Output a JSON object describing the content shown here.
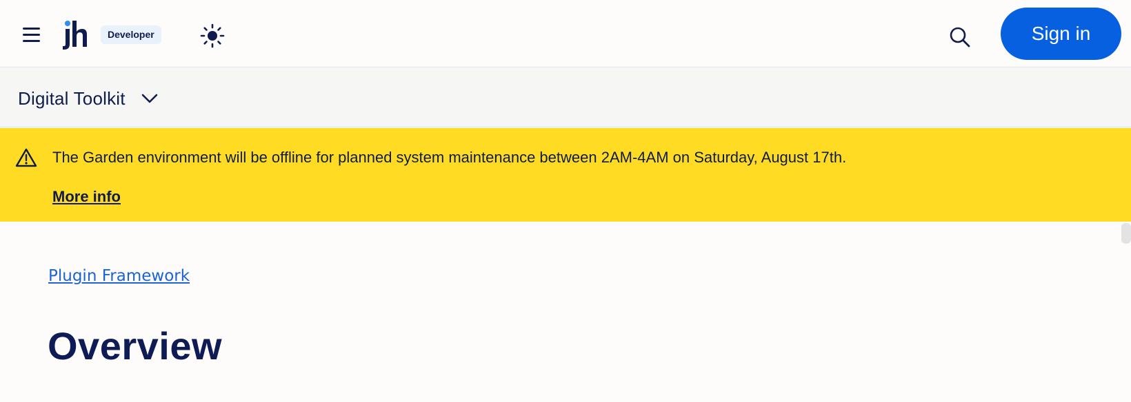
{
  "header": {
    "logo_text": "jh",
    "badge": "Developer",
    "sign_in_label": "Sign in"
  },
  "subnav": {
    "toolkit_label": "Digital Toolkit"
  },
  "banner": {
    "message": "The Garden environment will be offline for planned system maintenance between 2AM-4AM on Saturday, August 17th.",
    "link_label": "More info"
  },
  "content": {
    "breadcrumb": "Plugin Framework",
    "title": "Overview"
  },
  "icons": {
    "menu": "hamburger-menu-icon",
    "theme": "sun-icon",
    "search": "search-icon",
    "chevron": "chevron-down-icon",
    "warning": "warning-triangle-icon"
  },
  "colors": {
    "brand_navy": "#101b4e",
    "accent_blue": "#0660e0",
    "link_blue": "#1a64d6",
    "banner_yellow": "#ffdc23",
    "logo_dot": "#2a8ff0"
  }
}
